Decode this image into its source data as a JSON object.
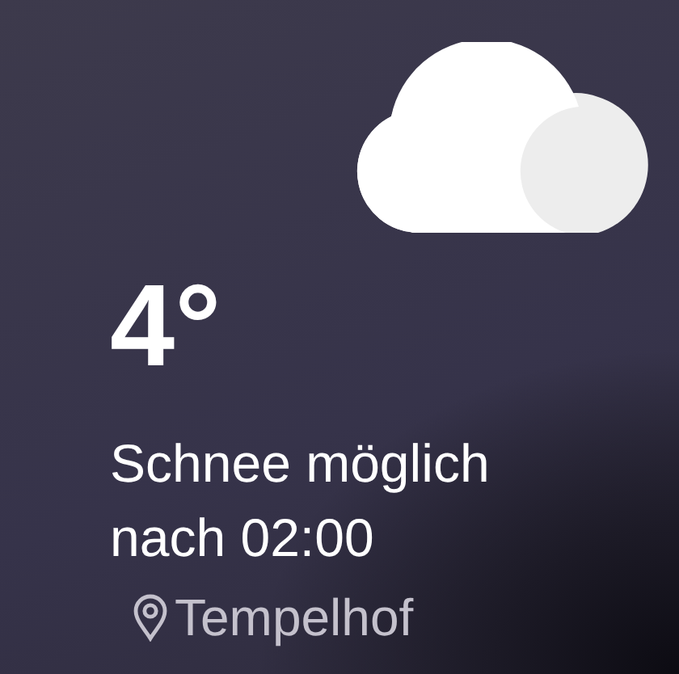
{
  "weather": {
    "temperature": "4°",
    "description": "Schnee möglich nach 02:00",
    "location": "Tempelhof"
  }
}
